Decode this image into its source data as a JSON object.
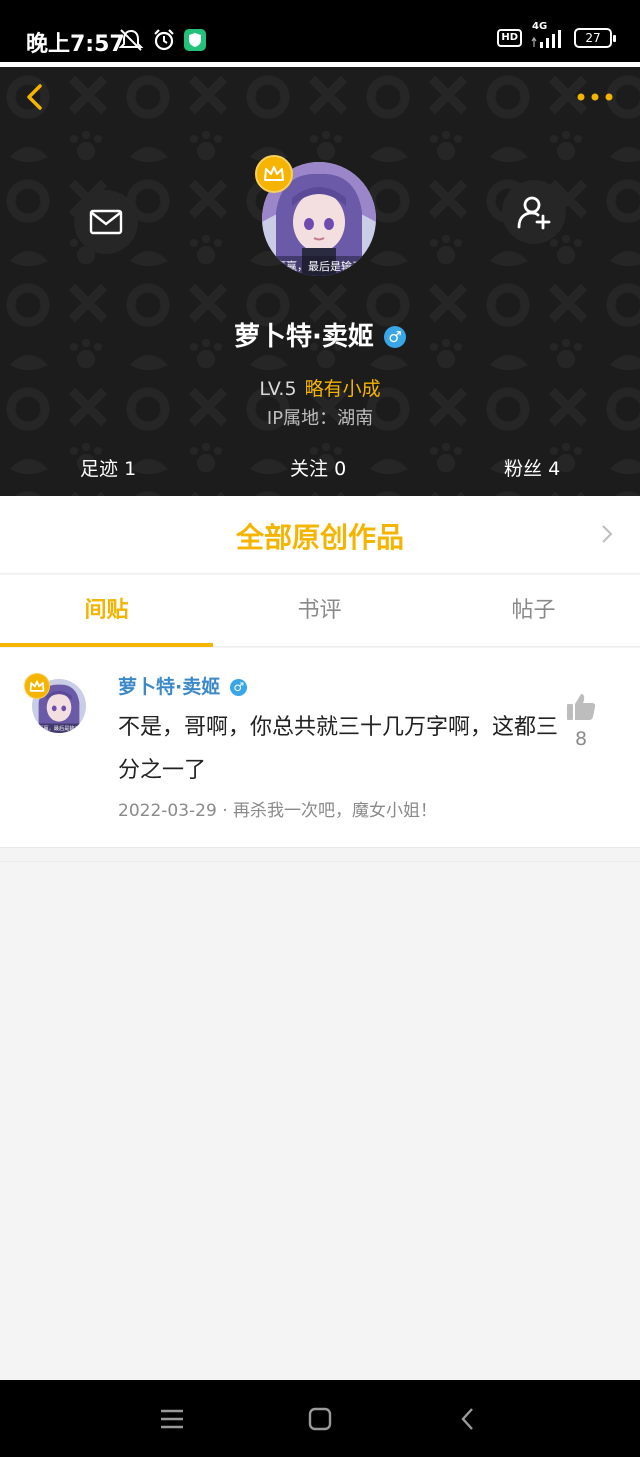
{
  "status_bar": {
    "time": "晚上7:57",
    "network": "4G",
    "hd": "HD",
    "battery": "27",
    "icons": [
      "mute-notification-icon",
      "alarm-icon",
      "shield-app-icon",
      "signal-icon",
      "battery-icon"
    ]
  },
  "profile": {
    "username": "萝卜特·卖姬",
    "gender_symbol": "♂",
    "level": "LV.5",
    "level_title": "略有小成",
    "ip_location": "IP属地：湖南",
    "avatar_caption": "赢赢，最后是输了",
    "stats": {
      "footprints_label": "足迹",
      "footprints_value": "1",
      "following_label": "关注",
      "following_value": "0",
      "fans_label": "粉丝",
      "fans_value": "4"
    }
  },
  "works": {
    "label": "全部原创作品"
  },
  "tabs": [
    {
      "label": "间贴",
      "active": true
    },
    {
      "label": "书评",
      "active": false
    },
    {
      "label": "帖子",
      "active": false
    }
  ],
  "post": {
    "author": "萝卜特·卖姬",
    "gender_symbol": "♂",
    "avatar_caption": "赢赢，最后是输了",
    "content": "不是，哥啊，你总共就三十几万字啊，这都三分之一了",
    "meta": "2022-03-29 · 再杀我一次吧，魔女小姐！",
    "likes": "8"
  },
  "colors": {
    "accent": "#f5b400",
    "link_blue": "#3b89c9",
    "gender_blue": "#39a6e8",
    "header_bg": "#1c1c1c"
  }
}
